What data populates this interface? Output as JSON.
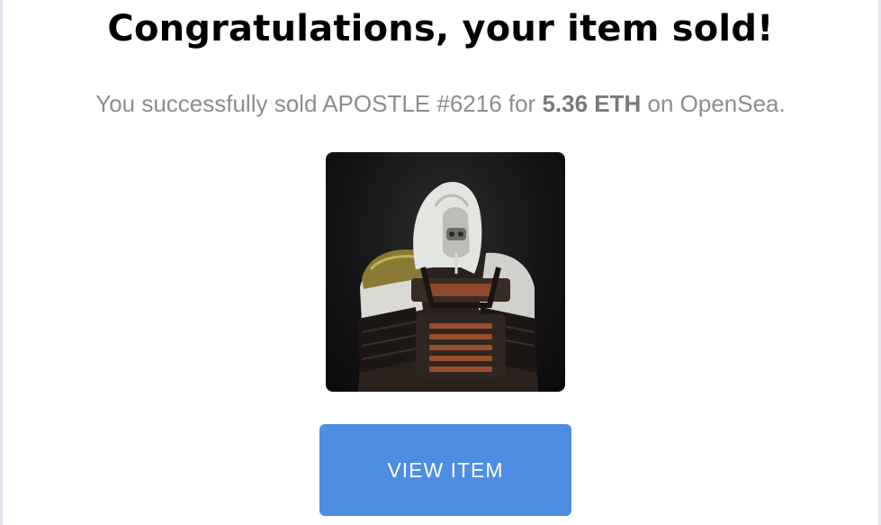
{
  "email": {
    "title": "Congratulations, your item sold!",
    "message": {
      "prefix": "You successfully sold APOSTLE #6216 for ",
      "amount": "5.36 ETH",
      "suffix": " on OpenSea."
    },
    "item_image": {
      "icon": "nft-apostle-image"
    },
    "button": {
      "label": "VIEW ITEM",
      "color": "#4d8ee2"
    }
  }
}
